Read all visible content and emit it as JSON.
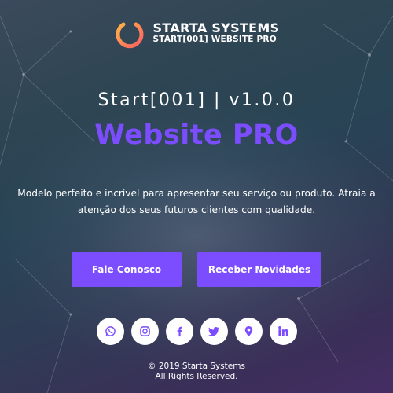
{
  "brand": {
    "name": "STARTA SYSTEMS",
    "subtitle": "START[001] WEBSITE PRO"
  },
  "hero": {
    "version": "Start[001] | v1.0.0",
    "title": "Website PRO",
    "description": "Modelo perfeito e incrível para apresentar seu serviço ou produto. Atraia a atenção dos seus futuros clientes com qualidade."
  },
  "buttons": {
    "contact": "Fale Conosco",
    "newsletter": "Receber Novidades"
  },
  "socials": [
    {
      "icon": "whatsapp-icon"
    },
    {
      "icon": "instagram-icon"
    },
    {
      "icon": "facebook-icon"
    },
    {
      "icon": "twitter-icon"
    },
    {
      "icon": "location-pin-icon"
    },
    {
      "icon": "linkedin-icon"
    }
  ],
  "footer": {
    "copyright": "© 2019 Starta Systems",
    "rights": "All Rights Reserved."
  },
  "colors": {
    "accent": "#7c4dff",
    "icon": "#7c4dff",
    "logo_gradient_start": "#ffb347",
    "logo_gradient_end": "#ff5e62"
  }
}
